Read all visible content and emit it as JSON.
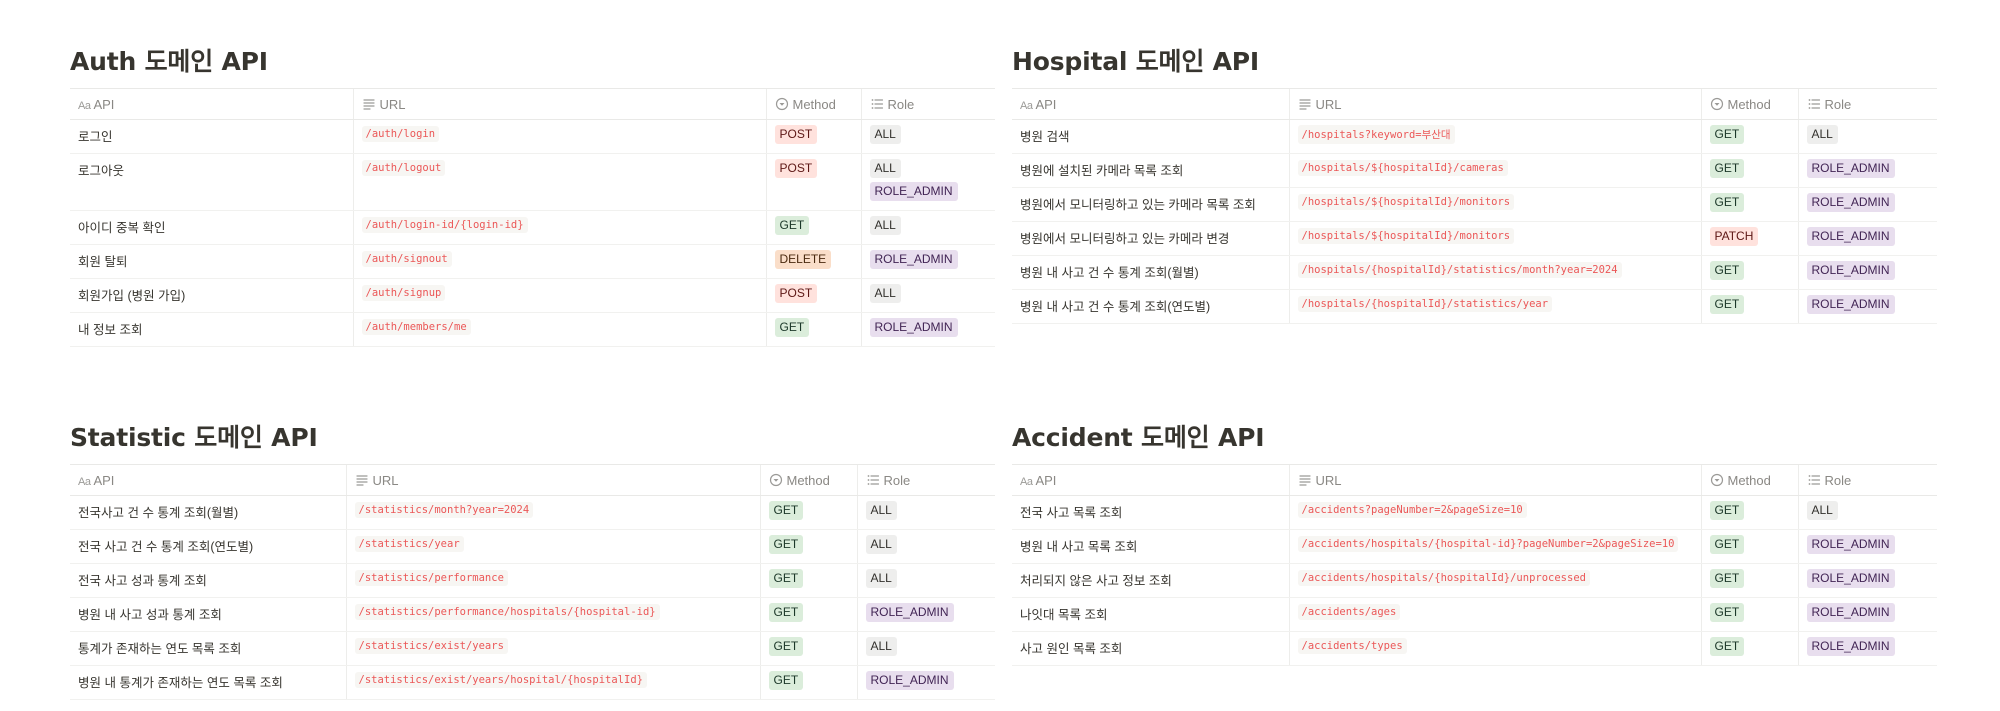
{
  "columns": {
    "api": "API",
    "url": "URL",
    "method": "Method",
    "role": "Role",
    "api_icon_text": "Aa"
  },
  "auth": {
    "title": "Auth 도메인 API",
    "rows": [
      {
        "api": "로그인",
        "url": "/auth/login",
        "method": "POST",
        "roles": [
          "ALL"
        ]
      },
      {
        "api": "로그아웃",
        "url": "/auth/logout",
        "method": "POST",
        "roles": [
          "ALL",
          "ROLE_ADMIN"
        ]
      },
      {
        "api": "아이디 중복 확인",
        "url": "/auth/login-id/{login-id}",
        "method": "GET",
        "roles": [
          "ALL"
        ]
      },
      {
        "api": "회원 탈퇴",
        "url": "/auth/signout",
        "method": "DELETE",
        "roles": [
          "ROLE_ADMIN"
        ]
      },
      {
        "api": "회원가입 (병원 가입)",
        "url": "/auth/signup",
        "method": "POST",
        "roles": [
          "ALL"
        ]
      },
      {
        "api": "내 정보 조회",
        "url": "/auth/members/me",
        "method": "GET",
        "roles": [
          "ROLE_ADMIN"
        ]
      }
    ]
  },
  "hospital": {
    "title": "Hospital 도메인 API",
    "rows": [
      {
        "api": "병원 검색",
        "url": "/hospitals?keyword=부산대",
        "method": "GET",
        "roles": [
          "ALL"
        ]
      },
      {
        "api": "병원에 설치된 카메라 목록 조회",
        "url": "/hospitals/${hospitalId}/cameras",
        "method": "GET",
        "roles": [
          "ROLE_ADMIN"
        ]
      },
      {
        "api": "병원에서 모니터링하고 있는 카메라 목록 조회",
        "url": "/hospitals/${hospitalId}/monitors",
        "method": "GET",
        "roles": [
          "ROLE_ADMIN"
        ]
      },
      {
        "api": "병원에서 모니터링하고 있는 카메라 변경",
        "url": "/hospitals/${hospitalId}/monitors",
        "method": "PATCH",
        "roles": [
          "ROLE_ADMIN"
        ]
      },
      {
        "api": "병원 내 사고 건 수 통계 조회(월별)",
        "url": "/hospitals/{hospitalId}/statistics/month?year=2024",
        "method": "GET",
        "roles": [
          "ROLE_ADMIN"
        ]
      },
      {
        "api": "병원 내 사고 건 수 통계 조회(연도별)",
        "url": "/hospitals/{hospitalId}/statistics/year",
        "method": "GET",
        "roles": [
          "ROLE_ADMIN"
        ]
      }
    ]
  },
  "statistic": {
    "title": "Statistic 도메인 API",
    "rows": [
      {
        "api": "전국사고 건 수 통계 조회(월별)",
        "url": "/statistics/month?year=2024",
        "method": "GET",
        "roles": [
          "ALL"
        ]
      },
      {
        "api": "전국 사고 건 수 통계 조회(연도별)",
        "url": "/statistics/year",
        "method": "GET",
        "roles": [
          "ALL"
        ]
      },
      {
        "api": "전국 사고 성과 통계 조회",
        "url": "/statistics/performance",
        "method": "GET",
        "roles": [
          "ALL"
        ]
      },
      {
        "api": "병원 내 사고 성과 통계 조회",
        "url": "/statistics/performance/hospitals/{hospital-id}",
        "method": "GET",
        "roles": [
          "ROLE_ADMIN"
        ]
      },
      {
        "api": "통계가 존재하는 연도 목록 조회",
        "url": "/statistics/exist/years",
        "method": "GET",
        "roles": [
          "ALL"
        ]
      },
      {
        "api": "병원 내 통계가 존재하는 연도 목록 조회",
        "url": "/statistics/exist/years/hospital/{hospitalId}",
        "method": "GET",
        "roles": [
          "ROLE_ADMIN"
        ]
      }
    ]
  },
  "accident": {
    "title": "Accident 도메인 API",
    "rows": [
      {
        "api": "전국 사고 목록 조회",
        "url": "/accidents?pageNumber=2&pageSize=10",
        "method": "GET",
        "roles": [
          "ALL"
        ]
      },
      {
        "api": "병원 내 사고 목록 조회",
        "url": "/accidents/hospitals/{hospital-id}?pageNumber=2&pageSize=10",
        "method": "GET",
        "roles": [
          "ROLE_ADMIN"
        ]
      },
      {
        "api": "처리되지 않은 사고 정보 조회",
        "url": "/accidents/hospitals/{hospitalId}/unprocessed",
        "method": "GET",
        "roles": [
          "ROLE_ADMIN"
        ]
      },
      {
        "api": "나잇대 목록 조회",
        "url": "/accidents/ages",
        "method": "GET",
        "roles": [
          "ROLE_ADMIN"
        ]
      },
      {
        "api": "사고 원인 목록 조회",
        "url": "/accidents/types",
        "method": "GET",
        "roles": [
          "ROLE_ADMIN"
        ]
      }
    ]
  },
  "colors": {
    "get": "#dbeddb",
    "post": "#ffe2dd",
    "delete": "#fadec9",
    "patch": "#ffe2dd",
    "all": "#eeeeed",
    "role_admin": "#e8deee",
    "url_text": "#eb5757"
  },
  "icons": {
    "api_column": "aa-text-icon",
    "url_column": "lines-icon",
    "method_column": "select-icon",
    "role_column": "list-icon"
  }
}
